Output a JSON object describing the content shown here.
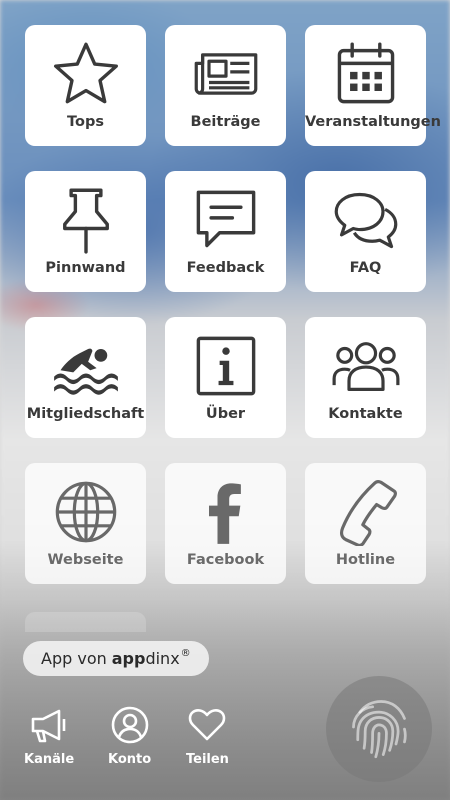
{
  "tiles": [
    {
      "label": "Tops",
      "icon": "star-icon"
    },
    {
      "label": "Beiträge",
      "icon": "newspaper-icon"
    },
    {
      "label": "Veranstaltungen",
      "icon": "calendar-icon"
    },
    {
      "label": "Pinnwand",
      "icon": "pushpin-icon"
    },
    {
      "label": "Feedback",
      "icon": "speech-bubble-icon"
    },
    {
      "label": "FAQ",
      "icon": "chat-bubbles-icon"
    },
    {
      "label": "Mitgliedschaft",
      "icon": "swimmer-icon"
    },
    {
      "label": "Über",
      "icon": "info-icon"
    },
    {
      "label": "Kontakte",
      "icon": "people-icon"
    },
    {
      "label": "Webseite",
      "icon": "globe-icon"
    },
    {
      "label": "Facebook",
      "icon": "facebook-icon"
    },
    {
      "label": "Hotline",
      "icon": "phone-icon"
    }
  ],
  "credit": {
    "prefix": "App von",
    "brand_bold": "app",
    "brand_rest": "dinx",
    "registered": "®"
  },
  "bottom_nav": [
    {
      "label": "Kanäle",
      "icon": "megaphone-icon"
    },
    {
      "label": "Konto",
      "icon": "account-icon"
    },
    {
      "label": "Teilen",
      "icon": "heart-icon"
    }
  ],
  "fab": {
    "icon": "fingerprint-icon"
  },
  "colors": {
    "tile_bg": "#ffffff",
    "icon_stroke": "#3a3a3a",
    "label_text": "#3a3a3a",
    "nav_text": "#ffffff"
  }
}
